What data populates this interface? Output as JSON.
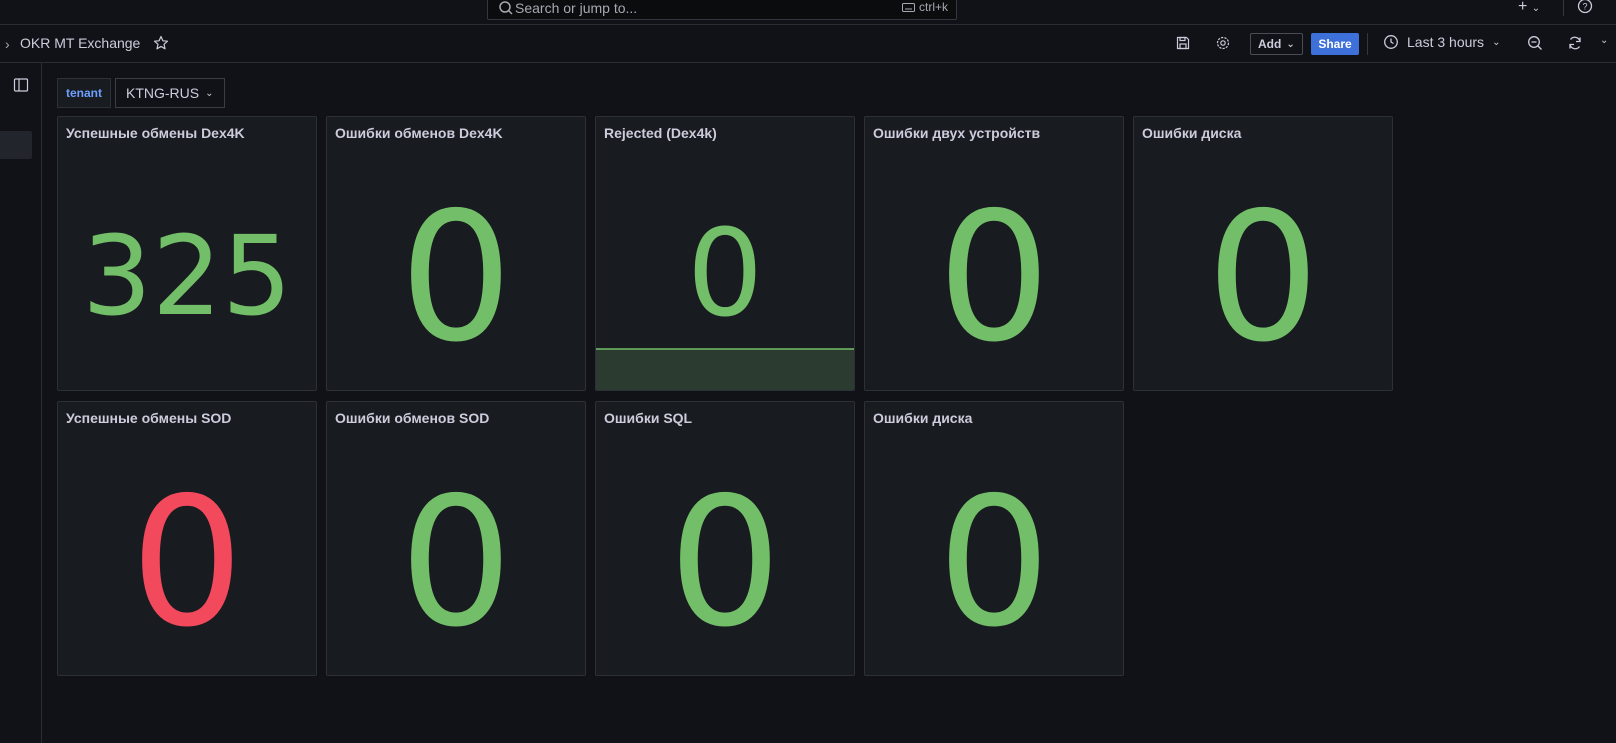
{
  "topbar": {
    "search_placeholder": "Search or jump to...",
    "search_shortcut": "ctrl+k"
  },
  "navbar": {
    "breadcrumb_title": "OKR MT Exchange",
    "add_label": "Add",
    "share_label": "Share",
    "time_range": "Last 3 hours"
  },
  "variables": {
    "label": "tenant",
    "value": "KTNG-RUS"
  },
  "colors": {
    "ok": "#73bf69",
    "bad": "#f2495c",
    "share": "#3d71d9"
  },
  "panels": [
    {
      "title": "Успешные обмены Dex4K",
      "value": "325",
      "status": "ok"
    },
    {
      "title": "Ошибки обменов Dex4K",
      "value": "0",
      "status": "ok"
    },
    {
      "title": "Rejected (Dex4k)",
      "value": "0",
      "status": "ok"
    },
    {
      "title": "Ошибки двух устройств",
      "value": "0",
      "status": "ok"
    },
    {
      "title": "Ошибки диска",
      "value": "0",
      "status": "ok"
    },
    {
      "title": "Успешные обмены SOD",
      "value": "0",
      "status": "bad"
    },
    {
      "title": "Ошибки обменов SOD",
      "value": "0",
      "status": "ok"
    },
    {
      "title": "Ошибки SQL",
      "value": "0",
      "status": "ok"
    },
    {
      "title": "Ошибки диска",
      "value": "0",
      "status": "ok"
    }
  ]
}
